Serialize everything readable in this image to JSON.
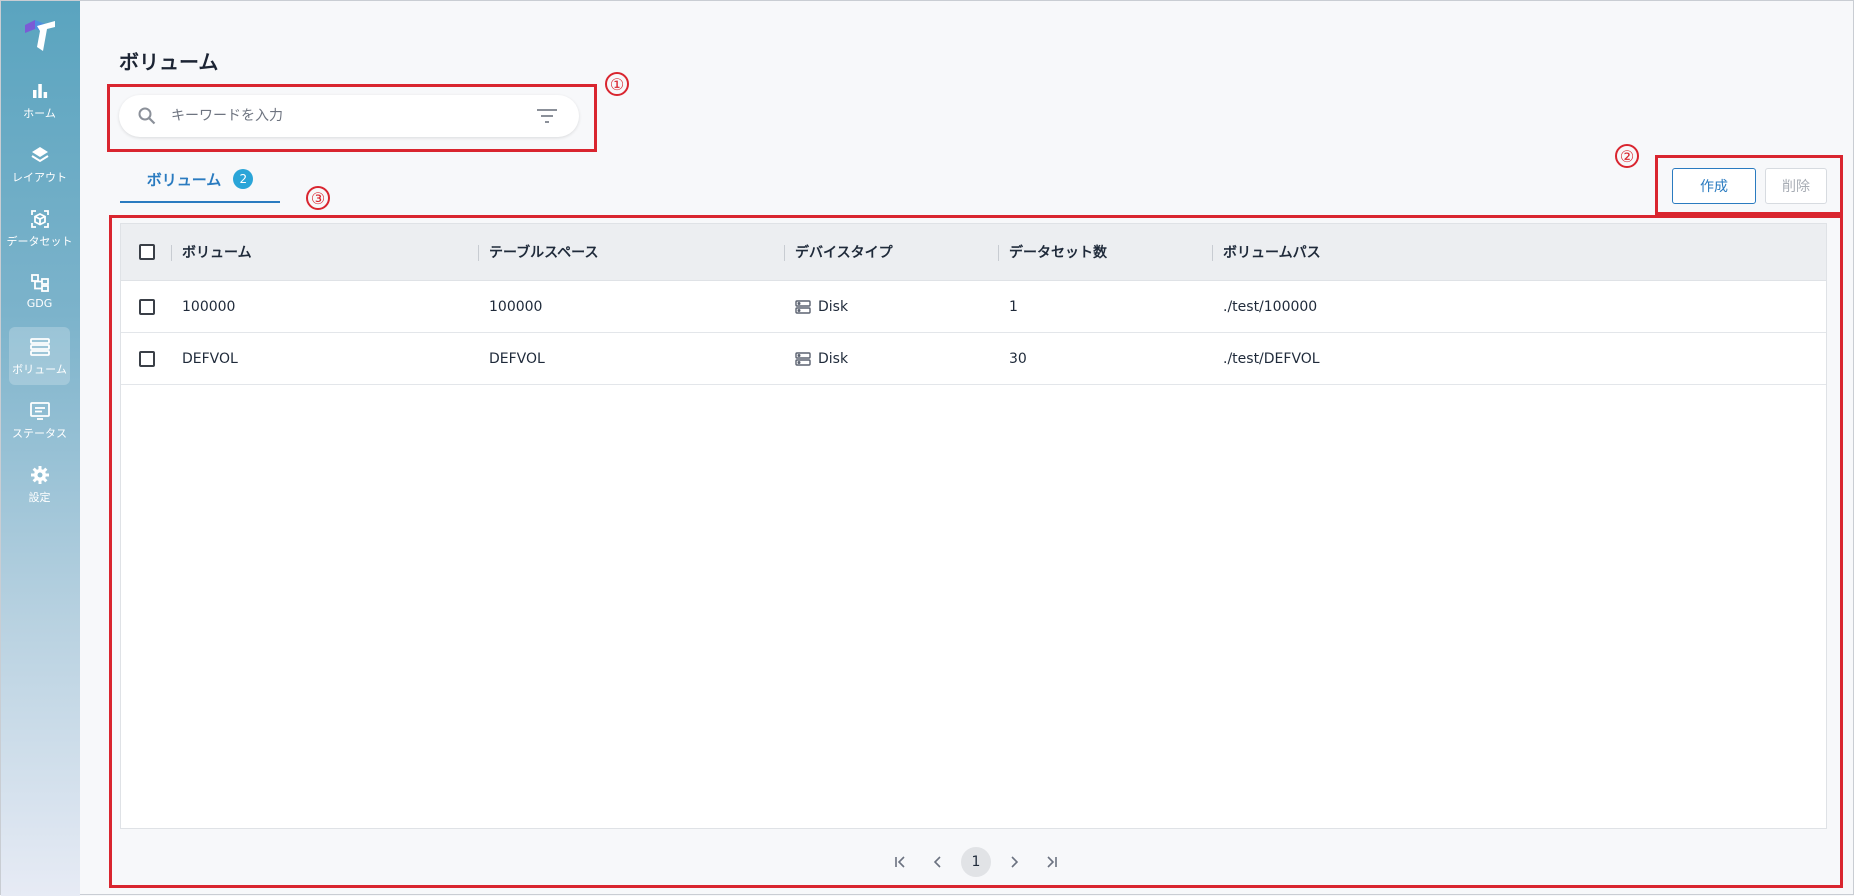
{
  "sidebar": {
    "items": [
      {
        "label": "ホーム",
        "icon": "bar-chart-icon"
      },
      {
        "label": "レイアウト",
        "icon": "layers-icon"
      },
      {
        "label": "データセット",
        "icon": "cube-scan-icon"
      },
      {
        "label": "GDG",
        "icon": "hierarchy-icon"
      },
      {
        "label": "ボリューム",
        "icon": "storage-list-icon",
        "active": true
      },
      {
        "label": "ステータス",
        "icon": "monitor-icon"
      },
      {
        "label": "設定",
        "icon": "gear-icon"
      }
    ]
  },
  "page": {
    "title": "ボリューム"
  },
  "search": {
    "placeholder": "キーワードを入力",
    "value": ""
  },
  "tabs": [
    {
      "label": "ボリューム",
      "count": "2"
    }
  ],
  "actions": {
    "create_label": "作成",
    "delete_label": "削除"
  },
  "annotations": [
    "①",
    "②",
    "③"
  ],
  "table": {
    "headers": [
      "ボリューム",
      "テーブルスペース",
      "デバイスタイプ",
      "データセット数",
      "ボリュームパス"
    ],
    "rows": [
      {
        "volume": "100000",
        "tablespace": "100000",
        "device": "Disk",
        "datasets": "1",
        "path": "./test/100000"
      },
      {
        "volume": "DEFVOL",
        "tablespace": "DEFVOL",
        "device": "Disk",
        "datasets": "30",
        "path": "./test/DEFVOL"
      }
    ]
  },
  "pagination": {
    "current": "1"
  },
  "colors": {
    "accent": "#2a7bc0",
    "annotation": "#d9252f",
    "badge": "#2aa5d8"
  }
}
